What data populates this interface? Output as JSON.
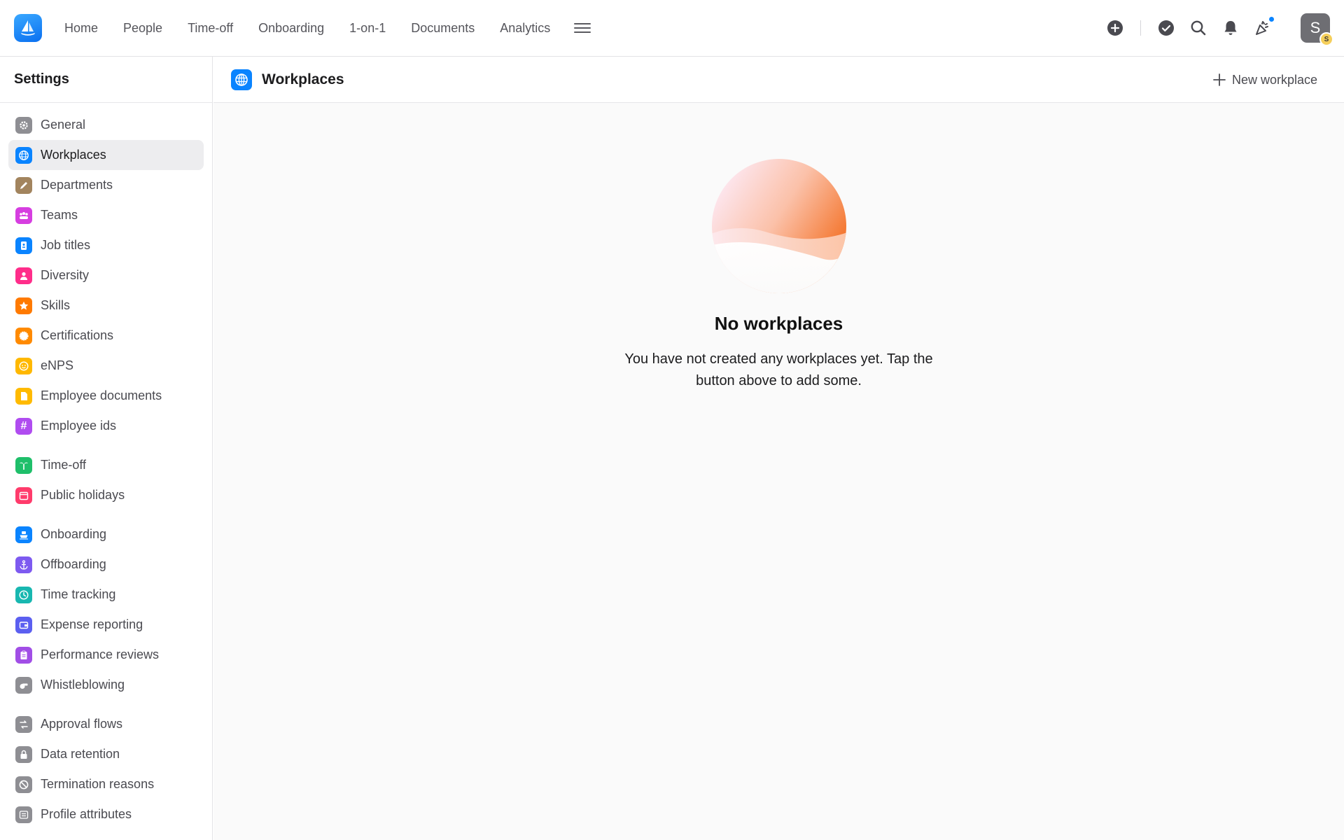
{
  "topbar": {
    "nav": [
      "Home",
      "People",
      "Time-off",
      "Onboarding",
      "1-on-1",
      "Documents",
      "Analytics"
    ],
    "avatar_initial": "S",
    "avatar_badge": "S"
  },
  "sidebar": {
    "title": "Settings",
    "groups": [
      [
        {
          "label": "General",
          "icon": "gear-icon",
          "color": "#8e8e93"
        },
        {
          "label": "Workplaces",
          "icon": "globe-icon",
          "color": "#0a84ff",
          "active": true
        },
        {
          "label": "Departments",
          "icon": "pencil-icon",
          "color": "#a2845e"
        },
        {
          "label": "Teams",
          "icon": "people-icon",
          "color": "#d63ee0"
        },
        {
          "label": "Job titles",
          "icon": "badge-icon",
          "color": "#0a84ff"
        },
        {
          "label": "Diversity",
          "icon": "person-icon",
          "color": "#ff2d8a"
        },
        {
          "label": "Skills",
          "icon": "star-icon",
          "color": "#ff7a00"
        },
        {
          "label": "Certifications",
          "icon": "seal-icon",
          "color": "#ff8a00"
        },
        {
          "label": "eNPS",
          "icon": "smiley-icon",
          "color": "#ffb800"
        },
        {
          "label": "Employee documents",
          "icon": "document-icon",
          "color": "#ffba00"
        },
        {
          "label": "Employee ids",
          "icon": "hash-icon",
          "color": "#b04cf0"
        }
      ],
      [
        {
          "label": "Time-off",
          "icon": "palm-tree-icon",
          "color": "#1fbf6a"
        },
        {
          "label": "Public holidays",
          "icon": "calendar-icon",
          "color": "#ff3b6b"
        }
      ],
      [
        {
          "label": "Onboarding",
          "icon": "ship-icon",
          "color": "#0a84ff"
        },
        {
          "label": "Offboarding",
          "icon": "anchor-icon",
          "color": "#7d5af0"
        },
        {
          "label": "Time tracking",
          "icon": "clock-icon",
          "color": "#18b7b0"
        },
        {
          "label": "Expense reporting",
          "icon": "wallet-icon",
          "color": "#5b5ff0"
        },
        {
          "label": "Performance reviews",
          "icon": "clipboard-icon",
          "color": "#a14ee6"
        },
        {
          "label": "Whistleblowing",
          "icon": "whistle-icon",
          "color": "#8e8e93"
        }
      ],
      [
        {
          "label": "Approval flows",
          "icon": "flow-icon",
          "color": "#8e8e93"
        },
        {
          "label": "Data retention",
          "icon": "lock-icon",
          "color": "#8e8e93"
        },
        {
          "label": "Termination reasons",
          "icon": "prohibited-icon",
          "color": "#8e8e93"
        },
        {
          "label": "Profile attributes",
          "icon": "list-icon",
          "color": "#8e8e93"
        }
      ]
    ]
  },
  "main": {
    "title": "Workplaces",
    "new_button": "New workplace",
    "empty_title": "No workplaces",
    "empty_text": "You have not created any workplaces yet. Tap the button above to add some."
  }
}
